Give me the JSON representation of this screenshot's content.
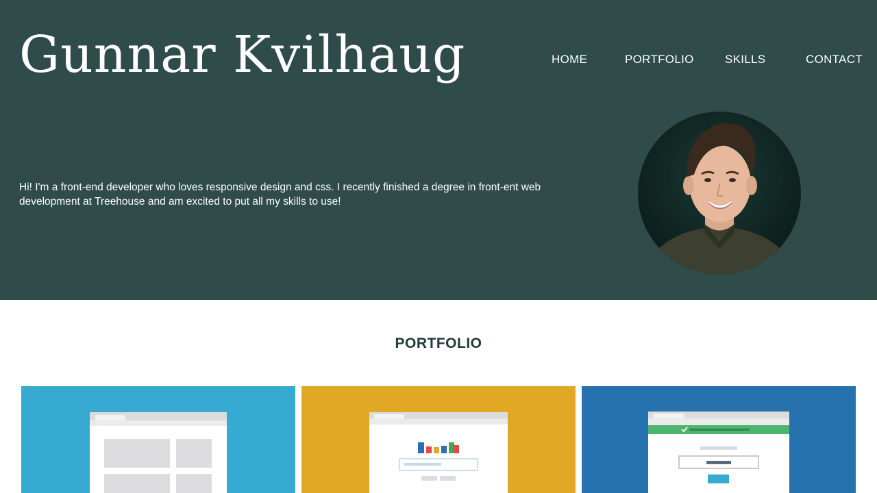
{
  "header": {
    "site_name": "Gunnar Kvilhaug"
  },
  "nav": {
    "items": [
      {
        "label": "HOME"
      },
      {
        "label": "PORTFOLIO"
      },
      {
        "label": "SKILLS"
      },
      {
        "label": "CONTACT"
      }
    ]
  },
  "intro": {
    "text": "Hi! I'm a front-end developer who loves responsive design and css. I recently finished a degree in front-ent web development at Treehouse and am excited to put all my skills to use!"
  },
  "portfolio": {
    "title": "PORTFOLIO"
  },
  "colors": {
    "hero_background": "#2f4b4a",
    "card_1": "#37aad2",
    "card_2": "#e0a825",
    "card_3": "#2572ae",
    "title_text": "#23393a"
  }
}
